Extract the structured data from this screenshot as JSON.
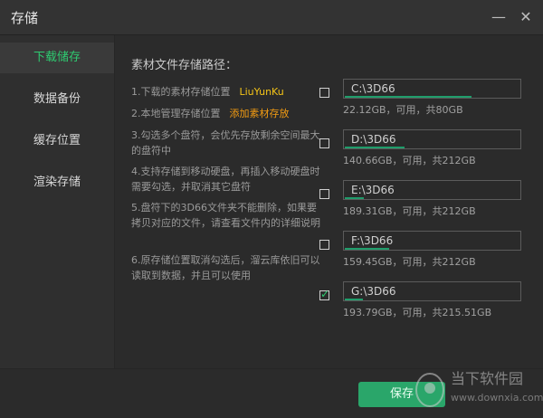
{
  "window": {
    "title": "存储",
    "controls": {
      "minimize_glyph": "—",
      "close_glyph": "✕"
    }
  },
  "sidebar": {
    "items": [
      {
        "label": "下载储存",
        "active": true
      },
      {
        "label": "数据备份",
        "active": false
      },
      {
        "label": "缓存位置",
        "active": false
      },
      {
        "label": "渲染存储",
        "active": false
      }
    ]
  },
  "main": {
    "section_title": "素材文件存储路径：",
    "notes": [
      {
        "text": "1.下载的素材存储位置",
        "link": "LiuYunKu"
      },
      {
        "text": "2.本地管理存储位置",
        "link": "添加素材存放"
      },
      {
        "text": "3.勾选多个盘符，会优先存放剩余空间最大的盘符中"
      },
      {
        "text": "4.支持存储到移动硬盘，再插入移动硬盘时需要勾选，并取消其它盘符"
      },
      {
        "text": "5.盘符下的3D66文件夹不能删除，如果要拷贝对应的文件，请查看文件内的详细说明"
      },
      {
        "text": "6.原存储位置取消勾选后，溜云库依旧可以读取到数据，并且可以使用"
      }
    ],
    "drives": [
      {
        "path": "C:\\3D66",
        "info": "22.12GB，可用，共80GB",
        "checked": false,
        "usage_fraction": 0.72
      },
      {
        "path": "D:\\3D66",
        "info": "140.66GB，可用，共212GB",
        "checked": false,
        "usage_fraction": 0.34
      },
      {
        "path": "E:\\3D66",
        "info": "189.31GB，可用，共212GB",
        "checked": false,
        "usage_fraction": 0.11
      },
      {
        "path": "F:\\3D66",
        "info": "159.45GB，可用，共212GB",
        "checked": false,
        "usage_fraction": 0.25
      },
      {
        "path": "G:\\3D66",
        "info": "193.79GB，可用，共215.51GB",
        "checked": true,
        "usage_fraction": 0.1
      }
    ]
  },
  "footer": {
    "save_label": "保存"
  },
  "watermark": {
    "line1": "当下软件园",
    "line2": "www.downxia.com"
  },
  "colors": {
    "accent": "#2ecc71",
    "save_button": "#2aa66a",
    "link_yellow": "#f5c518",
    "link_orange": "#f39c12",
    "background": "#2b2b2b"
  }
}
